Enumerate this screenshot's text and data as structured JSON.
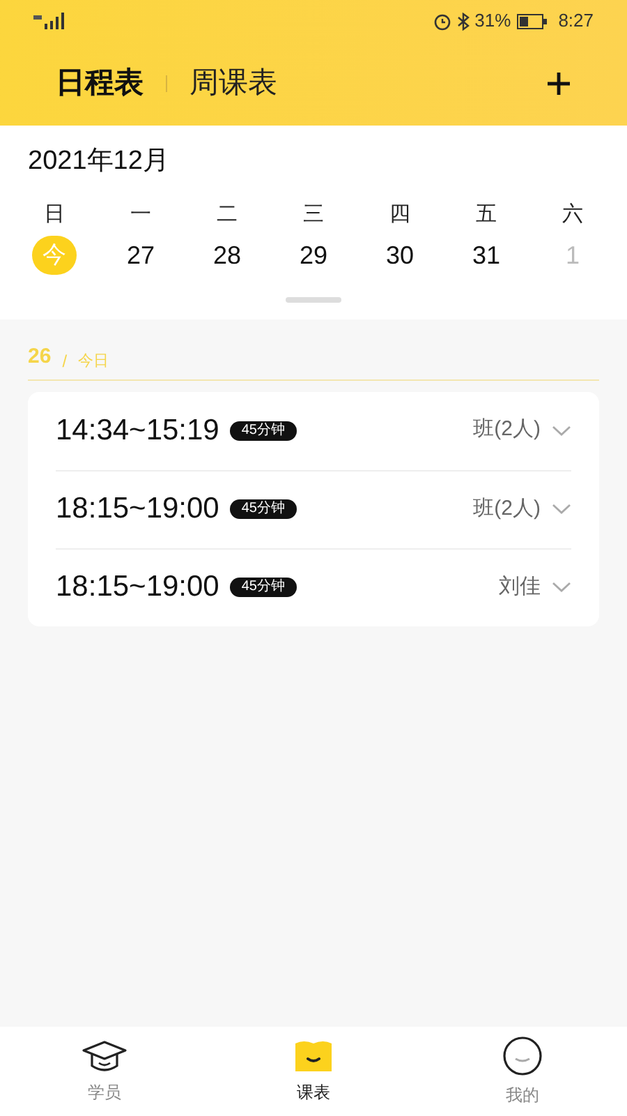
{
  "status_bar": {
    "battery": "31%",
    "time": "8:27"
  },
  "tabs": [
    {
      "label": "日程表",
      "selected": true
    },
    {
      "label": "周课表",
      "selected": false
    }
  ],
  "calendar": {
    "month": "2021年12月",
    "weekdays": [
      "日",
      "一",
      "二",
      "三",
      "四",
      "五",
      "六"
    ],
    "days": [
      {
        "label": "今",
        "selected": true,
        "muted": false
      },
      {
        "label": "27",
        "selected": false,
        "muted": false
      },
      {
        "label": "28",
        "selected": false,
        "muted": false
      },
      {
        "label": "29",
        "selected": false,
        "muted": false
      },
      {
        "label": "30",
        "selected": false,
        "muted": false
      },
      {
        "label": "31",
        "selected": false,
        "muted": false
      },
      {
        "label": "1",
        "selected": false,
        "muted": true
      }
    ]
  },
  "day_header": {
    "date": "26",
    "separator": "/",
    "label": "今日"
  },
  "lessons": [
    {
      "time": "14:34~15:19",
      "duration": "45分钟",
      "student": "班(2人)"
    },
    {
      "time": "18:15~19:00",
      "duration": "45分钟",
      "student": "班(2人)"
    },
    {
      "time": "18:15~19:00",
      "duration": "45分钟",
      "student": "刘佳"
    }
  ],
  "nav": [
    {
      "label": "学员",
      "selected": false,
      "kind": "cap"
    },
    {
      "label": "课表",
      "selected": true,
      "kind": "book"
    },
    {
      "label": "我的",
      "selected": false,
      "kind": "face"
    }
  ]
}
